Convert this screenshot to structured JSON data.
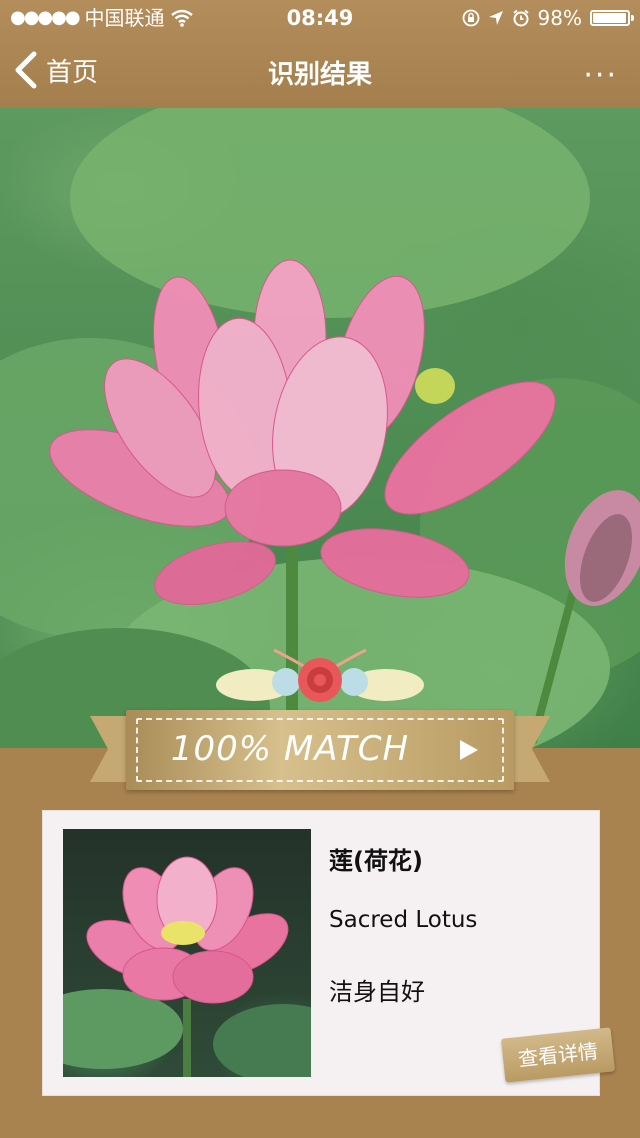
{
  "status_bar": {
    "signal_dots": "●●●●●",
    "carrier": "中国联通",
    "time": "08:49",
    "battery_percent": "98%",
    "battery_level": 0.98
  },
  "nav": {
    "back_label": "首页",
    "title": "识别结果",
    "more_label": "···"
  },
  "match": {
    "label": "100% MATCH"
  },
  "result": {
    "name_cn": "莲(荷花)",
    "name_en": "Sacred Lotus",
    "motto": "洁身自好",
    "detail_button": "查看详情"
  },
  "colors": {
    "brand_brown": "#a8824f",
    "card_bg": "#f5f1f2",
    "lotus_pink": "#e86a9a"
  },
  "icons": [
    "wifi-icon",
    "lock-rotation-icon",
    "location-arrow-icon",
    "alarm-icon",
    "battery-icon",
    "back-chevron-icon",
    "more-icon",
    "play-arrow-icon"
  ]
}
